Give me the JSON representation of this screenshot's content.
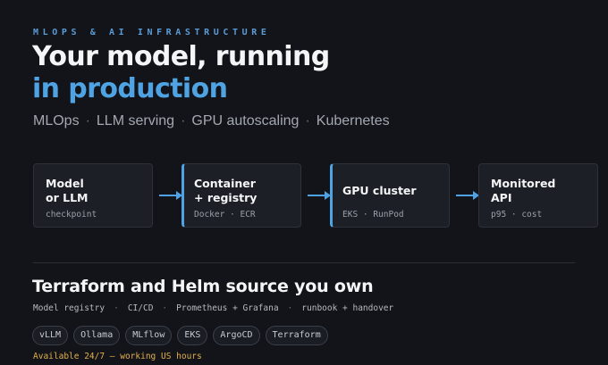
{
  "hero": {
    "eyebrow": "MLOPS & AI INFRASTRUCTURE",
    "title_line1": "Your model, running",
    "title_line2": "in production",
    "tags": [
      "MLOps",
      "LLM serving",
      "GPU autoscaling",
      "Kubernetes"
    ],
    "tag_separator": "·"
  },
  "pipeline": {
    "stages": [
      {
        "title": "Model\nor LLM",
        "sub": "checkpoint",
        "highlight": false
      },
      {
        "title": "Container\n+ registry",
        "sub": "Docker · ECR",
        "highlight": true
      },
      {
        "title": "GPU cluster",
        "sub": "EKS · RunPod",
        "highlight": true
      },
      {
        "title": "Monitored\nAPI",
        "sub": "p95 · cost",
        "highlight": false
      }
    ],
    "arrow_icon": "arrow-right-icon"
  },
  "ownership": {
    "title": "Terraform and Helm source you own",
    "deliverables": [
      "Model registry",
      "CI/CD",
      "Prometheus + Grafana",
      "runbook + handover"
    ],
    "separator": "·",
    "chips": [
      "vLLM",
      "Ollama",
      "MLflow",
      "EKS",
      "ArgoCD",
      "Terraform"
    ]
  },
  "availability": "Available 24/7 — working US hours",
  "colors": {
    "background": "#121419",
    "accent": "#4fa3e3",
    "availability": "#e3b04b"
  }
}
